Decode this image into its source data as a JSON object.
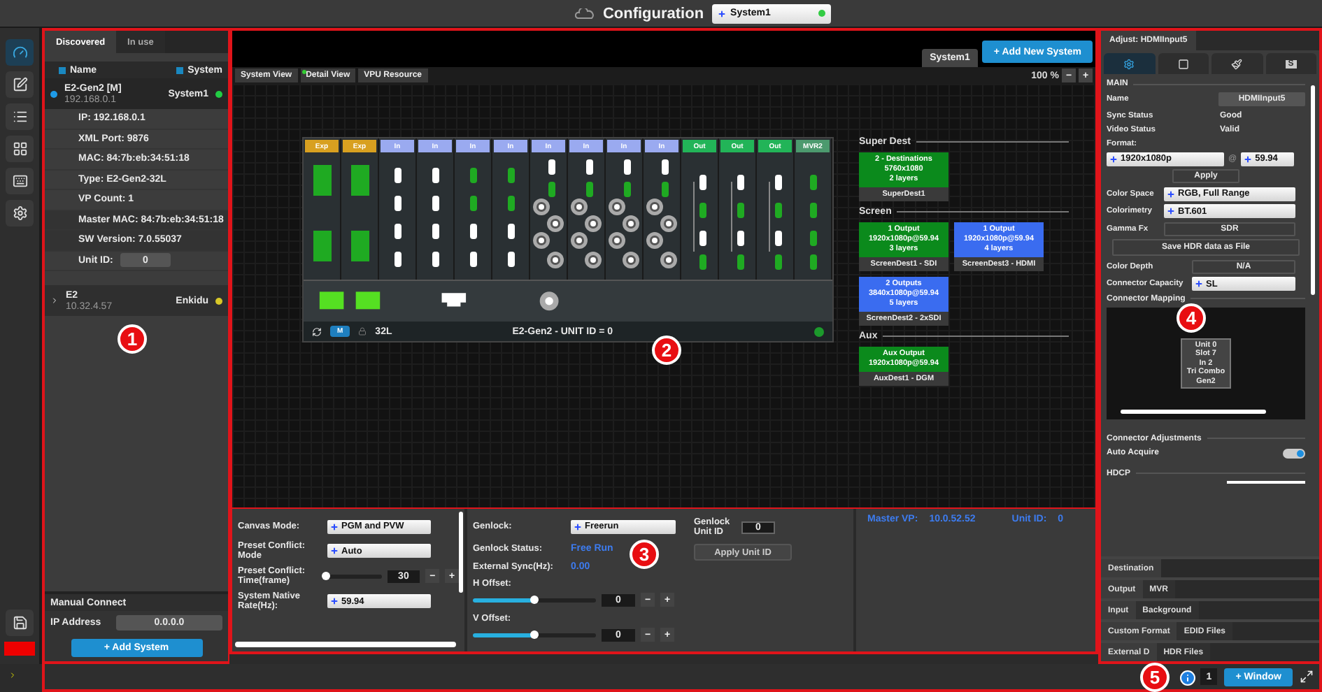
{
  "title_bar": {
    "title": "Configuration",
    "system_select": {
      "value": "System1",
      "color": "#33cc44"
    }
  },
  "rail": [
    {
      "kind": "dashboard",
      "selected": true
    },
    {
      "kind": "edit",
      "selected": false
    },
    {
      "kind": "list",
      "selected": false
    },
    {
      "kind": "grid",
      "selected": false
    },
    {
      "kind": "keyboard",
      "selected": false
    },
    {
      "kind": "settings",
      "selected": false
    }
  ],
  "discovery": {
    "tabs": [
      {
        "label": "Discovered",
        "selected": true
      },
      {
        "label": "In use",
        "selected": false
      }
    ],
    "columns": [
      "Name",
      "System"
    ],
    "devices": [
      {
        "name": "E2-Gen2 [M]",
        "ip": "192.168.0.1",
        "system": "System1",
        "color": "#22cc44",
        "expanded": true,
        "details": [
          "IP: 192.168.0.1",
          "XML Port: 9876",
          "MAC: 84:7b:eb:34:51:18",
          "Type: E2-Gen2-32L",
          "VP Count: 1",
          "Master MAC: 84:7b:eb:34:51:18",
          "SW Version: 7.0.55037"
        ],
        "unit_id": {
          "label": "Unit ID:",
          "value": "0"
        }
      },
      {
        "name": "E2",
        "ip": "10.32.4.57",
        "system": "Enkidu",
        "color": "#d8c828",
        "expanded": false
      }
    ],
    "manual_connect": {
      "title": "Manual Connect",
      "ip_label": "IP Address",
      "ip_value": "0.0.0.0",
      "button": "+ Add System"
    }
  },
  "center": {
    "system_tab": "System1",
    "add_button": "+ Add New System",
    "view_tabs": [
      {
        "label": "System View",
        "selected": false
      },
      {
        "label": "Detail View",
        "selected": true
      },
      {
        "label": "VPU Resource",
        "selected": false
      }
    ],
    "zoom": {
      "value": "100 %",
      "minus": "−",
      "plus": "+"
    }
  },
  "chassis": {
    "slots": [
      {
        "label": "Exp",
        "kind": "exp"
      },
      {
        "label": "Exp",
        "kind": "exp"
      },
      {
        "label": "In",
        "kind": "hdmi"
      },
      {
        "label": "In",
        "kind": "hdmi"
      },
      {
        "label": "In",
        "kind": "dp"
      },
      {
        "label": "In",
        "kind": "dp"
      },
      {
        "label": "In",
        "kind": "sdi"
      },
      {
        "label": "In",
        "kind": "sdi"
      },
      {
        "label": "In",
        "kind": "sdi"
      },
      {
        "label": "In",
        "kind": "sdi"
      },
      {
        "label": "Out",
        "kind": "out"
      },
      {
        "label": "Out",
        "kind": "out"
      },
      {
        "label": "Out",
        "kind": "out"
      },
      {
        "label": "MVR2",
        "kind": "mvr"
      }
    ],
    "mode": "M",
    "model": "32L",
    "title": "E2-Gen2 - UNIT ID = 0"
  },
  "destinations": [
    {
      "title": "Super Dest",
      "cards": [
        {
          "lines": [
            "2 - Destinations",
            "5760x1080",
            "2 layers"
          ],
          "name": "SuperDest1",
          "color": "#0b8a1c"
        }
      ]
    },
    {
      "title": "Screen",
      "cards": [
        {
          "lines": [
            "1 Output",
            "1920x1080p@59.94",
            "3 layers"
          ],
          "name": "ScreenDest1 - SDI",
          "color": "#0b8a1c"
        },
        {
          "lines": [
            "1 Output",
            "1920x1080p@59.94",
            "4 layers"
          ],
          "name": "ScreenDest3 - HDMI",
          "color": "#3a6cf0"
        },
        {
          "lines": [
            "2 Outputs",
            "3840x1080p@59.94",
            "5 layers"
          ],
          "name": "ScreenDest2 - 2xSDI",
          "color": "#3a6cf0"
        }
      ]
    },
    {
      "title": "Aux",
      "cards": [
        {
          "lines": [
            "Aux Output",
            "1920x1080p@59.94"
          ],
          "name": "AuxDest1 - DGM",
          "color": "#0b8a1c"
        }
      ]
    }
  ],
  "settings": {
    "fields": [
      {
        "kind": "select",
        "label": "Canvas Mode:",
        "value": "PGM and PVW"
      },
      {
        "kind": "select",
        "label": "Preset Conflict: Mode",
        "value": "Auto"
      },
      {
        "kind": "slider",
        "label": "Preset Conflict: Time(frame)",
        "level": 0,
        "value": "30",
        "minus": "−",
        "plus": "+"
      },
      {
        "kind": "select",
        "label": "System Native Rate(Hz):",
        "value": "59.94"
      }
    ],
    "genlock": {
      "label": "Genlock:",
      "value": "Freerun",
      "status_label": "Genlock Status:",
      "status": "Free Run",
      "sync_label": "External Sync(Hz):",
      "sync": "0.00",
      "offsets": [
        {
          "label": "H Offset:",
          "level": 0.5,
          "value": "0",
          "minus": "−",
          "plus": "+"
        },
        {
          "label": "V Offset:",
          "level": 0.5,
          "value": "0",
          "minus": "−",
          "plus": "+"
        }
      ],
      "unit_label": "Genlock Unit ID",
      "unit_value": "0",
      "apply": "Apply Unit ID"
    },
    "master": {
      "vp_label": "Master VP:",
      "vp": "10.0.52.52",
      "unit_label": "Unit ID:",
      "unit": "0"
    }
  },
  "adjust": {
    "title": "Adjust: HDMIInput5",
    "icon_tabs": [
      {
        "kind": "gear",
        "selected": true
      },
      {
        "kind": "crop",
        "selected": false
      },
      {
        "kind": "brush",
        "selected": false
      },
      {
        "kind": "letter",
        "label": "S",
        "selected": false
      }
    ],
    "section": "MAIN",
    "name_label": "Name",
    "name": "HDMIInput5",
    "sync_label": "Sync Status",
    "sync": "Good",
    "video_label": "Video Status",
    "video": "Valid",
    "format_label": "Format:",
    "format": "1920x1080p",
    "at": "@",
    "rate": "59.94",
    "apply": "Apply",
    "color_space_label": "Color Space",
    "color_space": "RGB, Full Range",
    "colorimetry_label": "Colorimetry",
    "colorimetry": "BT.601",
    "gamma_label": "Gamma Fx",
    "gamma": "SDR",
    "save_hdr": "Save HDR data as File",
    "depth_label": "Color Depth",
    "depth": "N/A",
    "capacity_label": "Connector Capacity",
    "capacity": "SL",
    "mapping_label": "Connector Mapping",
    "mapping_tip": [
      "Unit 0",
      "Slot 7",
      "In 2",
      "Tri Combo",
      "Gen2"
    ],
    "adjustments_label": "Connector Adjustments",
    "auto_acquire_label": "Auto Acquire",
    "auto_acquire": true,
    "hdcp_label": "HDCP",
    "tab_rows": [
      [
        "Destination"
      ],
      [
        "Output",
        "MVR"
      ],
      [
        "Input",
        "Background"
      ],
      [
        "Custom Format",
        "EDID Files"
      ],
      [
        "External D",
        "HDR Files"
      ]
    ]
  },
  "status_bar": {
    "page": "1",
    "window_button": "+ Window"
  },
  "callouts": [
    "1",
    "2",
    "3",
    "4",
    "5"
  ]
}
